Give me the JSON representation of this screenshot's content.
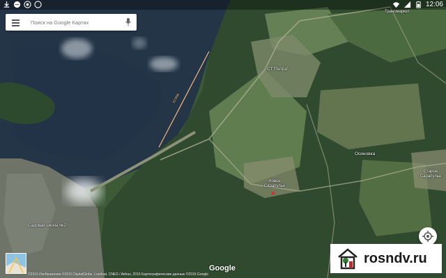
{
  "status": {
    "time": "12:06",
    "left_icons": [
      "download-icon",
      "message-icon",
      "chrome-icon",
      "compass-icon"
    ],
    "right_icons": [
      "wifi-icon",
      "signal-icon",
      "battery-icon"
    ]
  },
  "search": {
    "placeholder": "Поиск на Google Картах",
    "menu_icon": "hamburger-icon",
    "mic_icon": "mic-icon"
  },
  "map": {
    "labels": {
      "beach": "пляж",
      "st_petra": "СТ\"Петра\"",
      "osinovka": "Осиновка",
      "sarapulye_w": "Новое Сарапулье",
      "sarapulye_e": "Старое Сарапулье",
      "district": "Садовая школа №2",
      "top_right": "Трансмаркет"
    },
    "logo": "Google",
    "copyright": "©2016 Изображения ©2016 DigitalGlobe, Landsat, CNES / Airbus, 2016 Картографические данные ©2016 Google"
  },
  "watermark": {
    "text": "rosndv.ru"
  },
  "colors": {
    "water": "#243548",
    "forest": "#2f4a2e",
    "field": "#5f7d4f",
    "brand_green": "#2e7d32"
  }
}
